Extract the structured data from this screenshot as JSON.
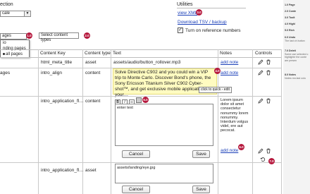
{
  "left_heading": "ection",
  "locale_select": "cale",
  "pages_select": "ages",
  "pages_options": [
    "io",
    "nding pages",
    "all pages"
  ],
  "content_type_select": "Select content types",
  "utilities": {
    "title": "Utilities",
    "view_xml": "view XML",
    "download": "Download TSV / backup",
    "ref_numbers": "Turn on reference numbers"
  },
  "badges": {
    "b1": "1.0",
    "b2": "2.0",
    "b3": "3.0",
    "b4": "4.0",
    "b5": "5.0",
    "b6": "6.0",
    "b7": "6.0",
    "b8": "7.0"
  },
  "table": {
    "headers": [
      "Content Key",
      "Content type",
      "Text",
      "Notes",
      "Controls"
    ],
    "rows": [
      {
        "page": "",
        "key": "html_meta_title",
        "type": "asset",
        "text": "assets/audio/button_rollover.mp3",
        "notes": "add note"
      },
      {
        "page": "ages",
        "key": "intro_align",
        "type": "content",
        "text": "Solve Directive C902 and you could win a VIP trip to Monte Carlo. Discover Bond's phone, the Sony Ericsson Titanium Silver C902 Cyber-shot™, and get exclusive mobile applications for your…",
        "notes": "add note"
      },
      {
        "page": "",
        "key": "intro_application_fl…",
        "type": "content",
        "text": "",
        "notes": "Lorem ipsum dolor sit amet consectetur nonummy lorem nonummy. Interdum volgus videl, ere aut pecocat."
      },
      {
        "page": "",
        "key": "intro_application_fl…",
        "type": "asset",
        "text": "",
        "notes": "add note"
      }
    ]
  },
  "tooltip": "click to quick - edit",
  "editor": {
    "value": "enter text",
    "cancel": "Cancel",
    "save": "Save"
  },
  "asset_editor": {
    "value": "assets/landing/eye.jpg",
    "cancel": "Cancel",
    "save": "Save"
  },
  "right_panel": [
    {
      "title": "1.0 Page",
      "body": ""
    },
    {
      "title": "2.0 Conte",
      "body": ""
    },
    {
      "title": "3.0 Toolt",
      "body": ""
    },
    {
      "title": "4.0 Highl",
      "body": ""
    },
    {
      "title": "5.0 Rich",
      "body": ""
    },
    {
      "title": "6.0 Undo",
      "body": "The last ch button"
    },
    {
      "title": "7.0 Deleti",
      "body": "Some use selected c highlighte the conte are presen"
    },
    {
      "title": "8.0 Notes",
      "body": "Notes rea last colu"
    }
  ]
}
